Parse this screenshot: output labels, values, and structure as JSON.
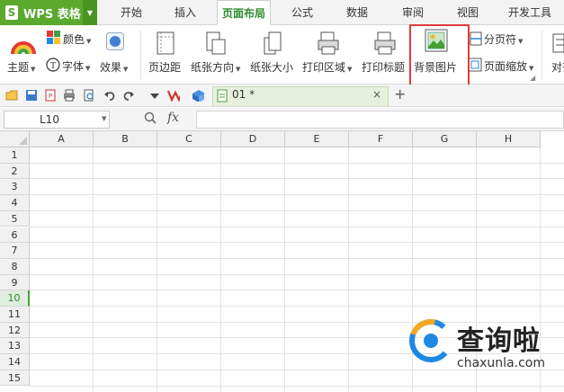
{
  "app": {
    "name": "WPS 表格",
    "logo_letter": "S"
  },
  "tabs": [
    {
      "label": "开始",
      "active": false
    },
    {
      "label": "插入",
      "active": false
    },
    {
      "label": "页面布局",
      "active": true
    },
    {
      "label": "公式",
      "active": false
    },
    {
      "label": "数据",
      "active": false
    },
    {
      "label": "审阅",
      "active": false
    },
    {
      "label": "视图",
      "active": false
    },
    {
      "label": "开发工具",
      "active": false
    }
  ],
  "ribbon": {
    "theme": "主题",
    "colors": "颜色",
    "fonts": "字体",
    "effects": "效果",
    "margins": "页边距",
    "orientation": "纸张方向",
    "size": "纸张大小",
    "print_area": "打印区域",
    "print_titles": "打印标题",
    "background": "背景图片",
    "page_break": "分页符",
    "page_scale": "页面缩放",
    "align": "对齐"
  },
  "document": {
    "tab_title": "01 *",
    "close": "×",
    "add": "+"
  },
  "formula_bar": {
    "cell_ref": "L10",
    "fx": "fx",
    "formula": ""
  },
  "grid": {
    "columns": [
      "A",
      "B",
      "C",
      "D",
      "E",
      "F",
      "G",
      "H"
    ],
    "rows": [
      "1",
      "2",
      "3",
      "4",
      "5",
      "6",
      "7",
      "8",
      "9",
      "10",
      "11",
      "12",
      "13",
      "14",
      "15"
    ],
    "selected_row": "10"
  },
  "watermark": {
    "text": "查询啦",
    "url": "chaxunla.com"
  },
  "colors": {
    "accent": "#5aa82c",
    "highlight": "#e23a3a",
    "active_tab": "#2e8b2e"
  }
}
